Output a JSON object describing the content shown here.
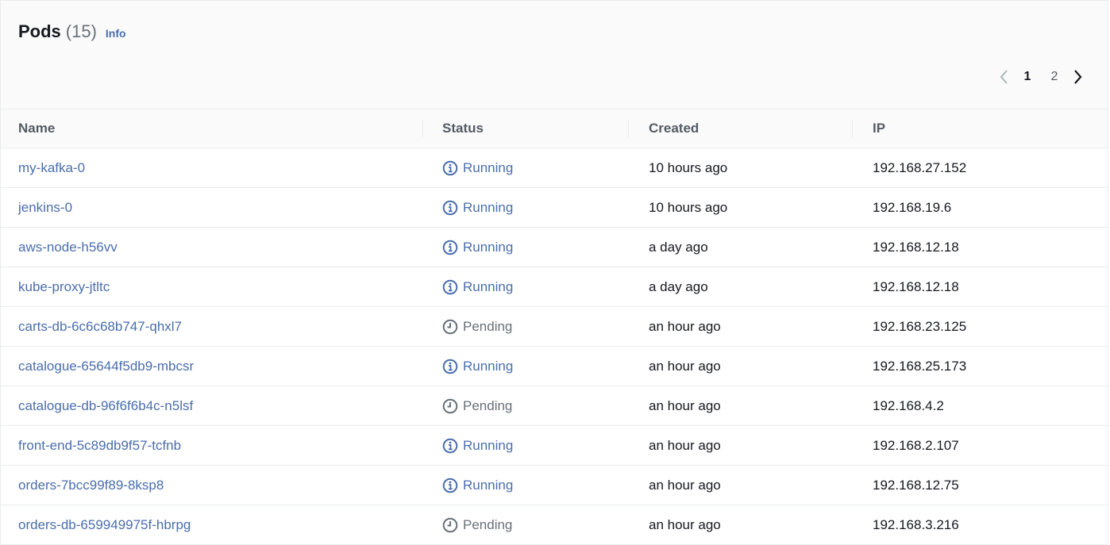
{
  "header": {
    "title": "Pods",
    "count": "(15)",
    "info_label": "Info"
  },
  "pagination": {
    "pages": [
      "1",
      "2"
    ],
    "current_page": "1"
  },
  "table": {
    "columns": [
      "Name",
      "Status",
      "Created",
      "IP"
    ],
    "rows": [
      {
        "name": "my-kafka-0",
        "status": "Running",
        "created": "10 hours ago",
        "ip": "192.168.27.152"
      },
      {
        "name": "jenkins-0",
        "status": "Running",
        "created": "10 hours ago",
        "ip": "192.168.19.6"
      },
      {
        "name": "aws-node-h56vv",
        "status": "Running",
        "created": "a day ago",
        "ip": "192.168.12.18"
      },
      {
        "name": "kube-proxy-jtltc",
        "status": "Running",
        "created": "a day ago",
        "ip": "192.168.12.18"
      },
      {
        "name": "carts-db-6c6c68b747-qhxl7",
        "status": "Pending",
        "created": "an hour ago",
        "ip": "192.168.23.125"
      },
      {
        "name": "catalogue-65644f5db9-mbcsr",
        "status": "Running",
        "created": "an hour ago",
        "ip": "192.168.25.173"
      },
      {
        "name": "catalogue-db-96f6f6b4c-n5lsf",
        "status": "Pending",
        "created": "an hour ago",
        "ip": "192.168.4.2"
      },
      {
        "name": "front-end-5c89db9f57-tcfnb",
        "status": "Running",
        "created": "an hour ago",
        "ip": "192.168.2.107"
      },
      {
        "name": "orders-7bcc99f89-8ksp8",
        "status": "Running",
        "created": "an hour ago",
        "ip": "192.168.12.75"
      },
      {
        "name": "orders-db-659949975f-hbrpg",
        "status": "Pending",
        "created": "an hour ago",
        "ip": "192.168.3.216"
      }
    ]
  },
  "colors": {
    "link": "#4a6eac",
    "running_icon": "#4a6eac",
    "pending_icon": "#687078",
    "header_bg": "#fafafa",
    "border": "#eaeded"
  },
  "icons": {
    "running": "info-circle-icon",
    "pending": "clock-icon",
    "prev": "chevron-left-icon",
    "next": "chevron-right-icon"
  }
}
